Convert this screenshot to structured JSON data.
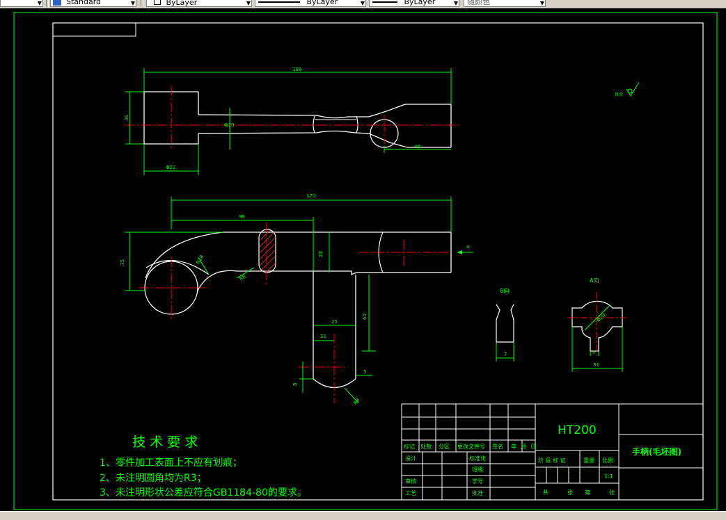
{
  "toolbar": {
    "left_dropdown_value": "",
    "text_style_value": "Standard",
    "layer_value": "ByLayer",
    "linetype_value": "ByLayer",
    "lineweight_value": "ByLayer",
    "color_value": "随颜色"
  },
  "drawing": {
    "top_view": {
      "overall_length": "186",
      "left_block_height": "36",
      "left_block_width": "Φ22",
      "shank_dia": "Φ10",
      "end_dim": "40"
    },
    "front_view": {
      "overall_length": "170",
      "inner_length": "95",
      "height": "35",
      "radius_large": "R18",
      "radius_small": "R8",
      "slot_height": "23",
      "lower_width": "25",
      "lower_offset": "11",
      "lower_height": "60",
      "foot_height": "8",
      "foot_gap": "5",
      "foot_radius": "R8",
      "view_arrow_label": "A"
    },
    "section_b": {
      "title": "B向",
      "dim": "7"
    },
    "section_a": {
      "title": "A向",
      "dia": "Φ20",
      "width": "31",
      "slot": "8"
    },
    "roughness_note": "其余"
  },
  "requirements": {
    "title": "技 术 要 求",
    "items": [
      "1、零件加工表面上不应有划痕；",
      "2、未注明圆角均为R3；",
      "3、未注明形状公差应符合GB1184-80的要求。"
    ]
  },
  "title_block": {
    "material": "HT200",
    "part_name": "手柄(毛坯图)",
    "row_labels_left": [
      "标记",
      "处数",
      "分区",
      "更改文件号",
      "签名",
      "年",
      "月",
      "日"
    ],
    "design": "设计",
    "standardization": "标准化",
    "class": "班级",
    "review": "审核",
    "student_no": "学号",
    "process": "工艺",
    "approve": "批准",
    "stage_mark": "阶 段 标 记",
    "weight": "重量",
    "scale": "比例",
    "scale_value": "1:1",
    "total": "共",
    "sheets": "张",
    "sheet_no": "第",
    "sheet": "张"
  },
  "colors": {
    "line_white": "#ffffff",
    "dim_green": "#00ff00",
    "center_red": "#ff0000",
    "hatch_red": "#ff3030",
    "background": "#000000"
  }
}
